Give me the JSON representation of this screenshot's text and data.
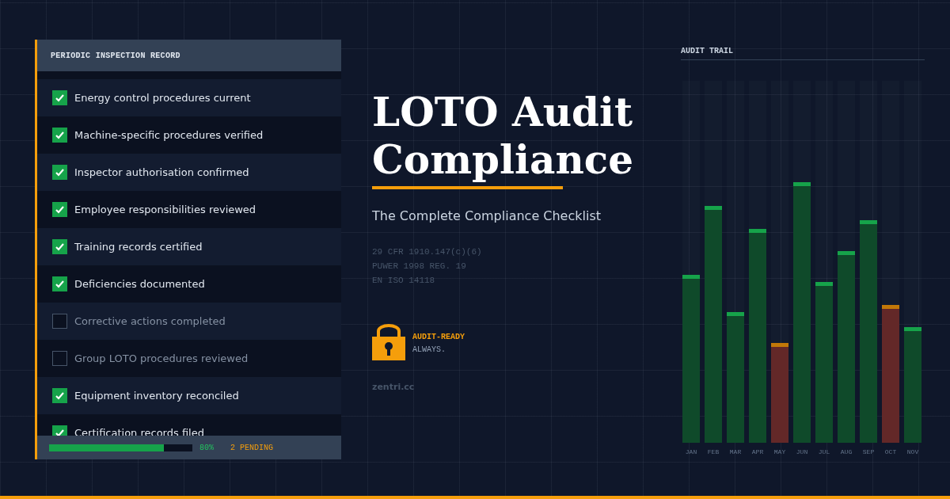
{
  "checklist": {
    "title": "PERIODIC INSPECTION RECORD",
    "items": [
      {
        "label": "Energy control procedures current",
        "checked": true
      },
      {
        "label": "Machine-specific procedures verified",
        "checked": true
      },
      {
        "label": "Inspector authorisation confirmed",
        "checked": true
      },
      {
        "label": "Employee responsibilities reviewed",
        "checked": true
      },
      {
        "label": "Training records certified",
        "checked": true
      },
      {
        "label": "Deficiencies documented",
        "checked": true
      },
      {
        "label": "Corrective actions completed",
        "checked": false
      },
      {
        "label": "Group LOTO procedures reviewed",
        "checked": false
      },
      {
        "label": "Equipment inventory reconciled",
        "checked": true
      },
      {
        "label": "Certification records filed",
        "checked": true
      }
    ],
    "progress": {
      "level": 0.8,
      "reading": "80%",
      "pending": "2 PENDING"
    }
  },
  "hero": {
    "title_lines": [
      "LOTO Audit",
      "Compliance"
    ],
    "subtitle": "The Complete Compliance Checklist",
    "references": [
      "29 CFR 1910.147(c)(6)",
      "PUWER 1998 REG. 19",
      "EN ISO 14118"
    ],
    "badge": {
      "heading": "AUDIT-READY",
      "text": "ALWAYS."
    },
    "site": "zentri.cc"
  },
  "audit_trail": {
    "title": "AUDIT TRAIL",
    "bars": [
      {
        "label": "JAN",
        "level": 0.465,
        "flagged": false
      },
      {
        "label": "FEB",
        "level": 0.655,
        "flagged": false
      },
      {
        "label": "MAR",
        "level": 0.36,
        "flagged": false
      },
      {
        "label": "APR",
        "level": 0.59,
        "flagged": false
      },
      {
        "label": "MAY",
        "level": 0.275,
        "flagged": true
      },
      {
        "label": "JUN",
        "level": 0.72,
        "flagged": false
      },
      {
        "label": "JUL",
        "level": 0.445,
        "flagged": false
      },
      {
        "label": "AUG",
        "level": 0.53,
        "flagged": false
      },
      {
        "label": "SEP",
        "level": 0.615,
        "flagged": false
      },
      {
        "label": "OCT",
        "level": 0.38,
        "flagged": true
      },
      {
        "label": "NOV",
        "level": 0.32,
        "flagged": false
      }
    ]
  }
}
